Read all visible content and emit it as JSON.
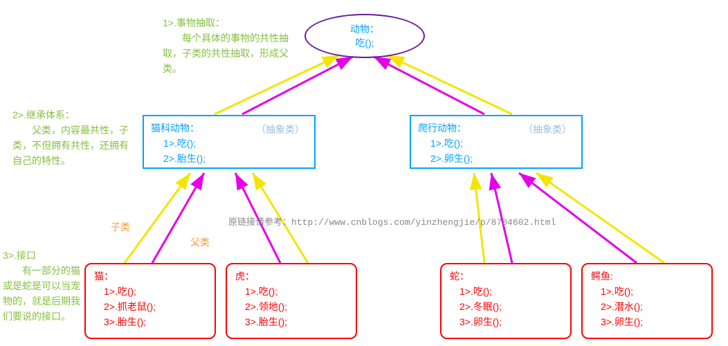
{
  "diagram": {
    "top": {
      "title": "动物：",
      "method": "吃();"
    },
    "note1": {
      "heading": "1>.事物抽取：",
      "body": "每个具体的事物的共性抽取，子类的共性抽取，形成父类。"
    },
    "note2": {
      "heading": "2>.继承体系：",
      "body": "父类，内容最共性，子类，不但拥有共性，还拥有自己的特性。"
    },
    "note3": {
      "heading": "3>.接口",
      "body": "有一部分的猫或是蛇是可以当宠物的，就是后期我们要说的接口。"
    },
    "mid_left": {
      "title": "猫科动物：",
      "m1": "1>.吃();",
      "m2": "2>.胎生();",
      "badge": "（抽象类）"
    },
    "mid_right": {
      "title": "爬行动物：",
      "m1": "1>.吃();",
      "m2": "2>.卵生();",
      "badge": "（抽象类）"
    },
    "leaf_cat": {
      "title": "猫：",
      "m1": "1>.吃();",
      "m2": "2>.抓老鼠();",
      "m3": "3>.胎生();"
    },
    "leaf_tiger": {
      "title": "虎：",
      "m1": "1>.吃();",
      "m2": "2>.领地();",
      "m3": "3>.胎生();"
    },
    "leaf_snake": {
      "title": "蛇：",
      "m1": "1>.吃();",
      "m2": "2>.冬眠();",
      "m3": "3>.卵生();"
    },
    "leaf_croc": {
      "title": "鳄鱼:",
      "m1": "1>.吃();",
      "m2": "2>.潜水();",
      "m3": "3>.卵生();"
    },
    "label_subclass": "子类",
    "label_superclass": "父类",
    "watermark": "原链接请参考：http://www.cnblogs.com/yinzhengjie/p/8784602.html"
  }
}
